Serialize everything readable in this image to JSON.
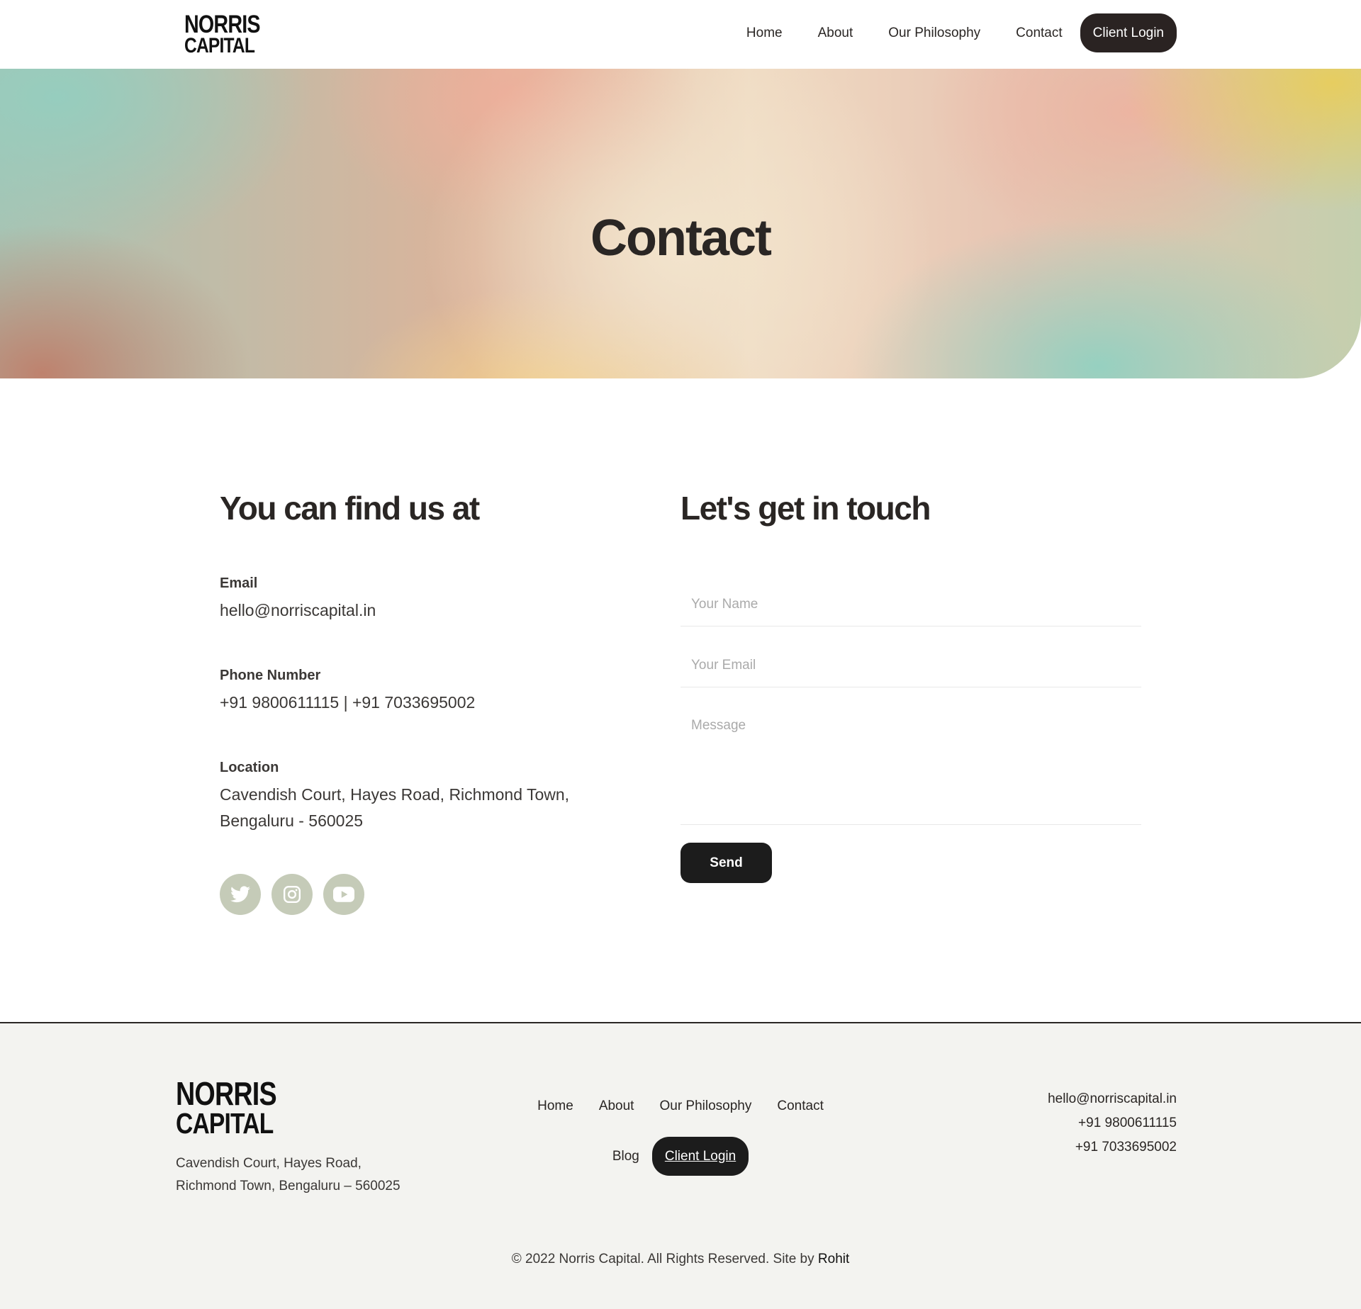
{
  "brand": {
    "line1": "NORRIS",
    "line2": "CAPITAL"
  },
  "nav": {
    "items": [
      "Home",
      "About",
      "Our Philosophy",
      "Contact"
    ],
    "client_login": "Client Login"
  },
  "hero": {
    "title": "Contact"
  },
  "find_us": {
    "heading": "You can find us at",
    "email_label": "Email",
    "email_value": "hello@norriscapital.in",
    "phone_label": "Phone Number",
    "phone_value": "+91 9800611115 | +91 7033695002",
    "location_label": "Location",
    "location_line1": "Cavendish Court, Hayes Road, Richmond Town,",
    "location_line2": "Bengaluru - 560025",
    "socials": [
      "twitter-icon",
      "instagram-icon",
      "youtube-icon"
    ]
  },
  "form": {
    "heading": "Let's get in touch",
    "name_placeholder": "Your Name",
    "email_placeholder": "Your Email",
    "message_placeholder": "Message",
    "send_label": "Send"
  },
  "footer": {
    "address_line1": "Cavendish Court, Hayes Road,",
    "address_line2": "Richmond Town, Bengaluru – 560025",
    "nav": [
      "Home",
      "About",
      "Our Philosophy",
      "Contact"
    ],
    "blog": "Blog",
    "client_login": "Client Login",
    "email": "hello@norriscapital.in",
    "phone1": "+91 9800611115",
    "phone2": "+91 7033695002",
    "copyright": "© 2022 Norris Capital. All Rights Reserved. Site by",
    "site_by": "Rohit"
  },
  "colors": {
    "dark": "#2a2322",
    "social_bg": "#c5cbb8",
    "footer_bg": "#f3f3f0"
  }
}
